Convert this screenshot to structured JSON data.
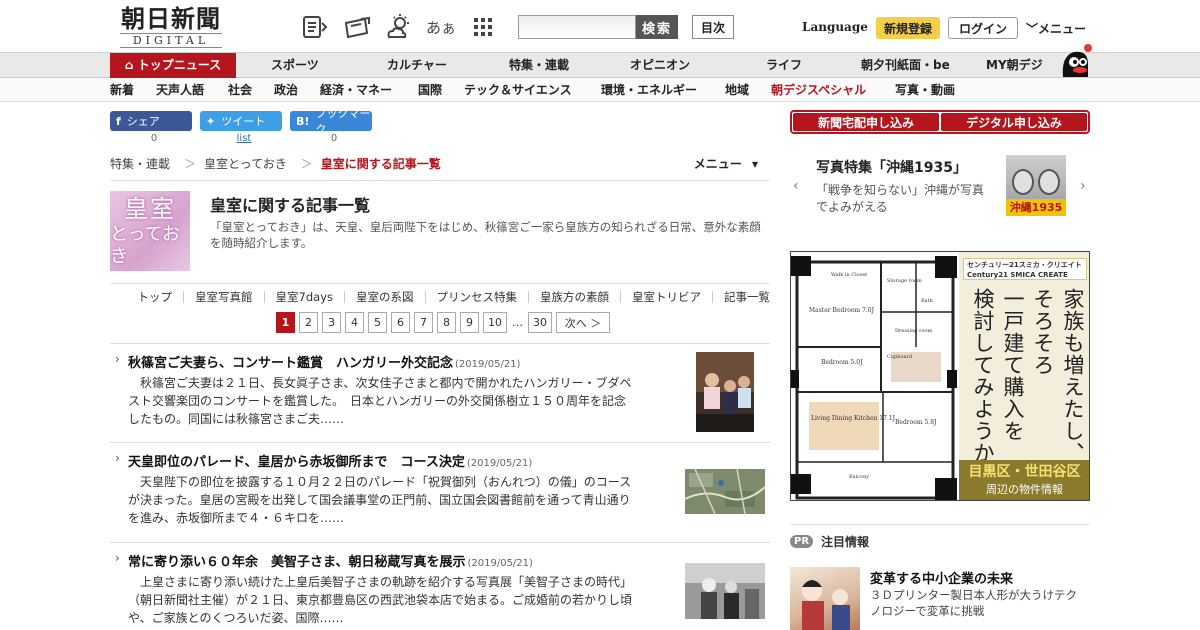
{
  "header": {
    "logo_jp": "朝日新聞",
    "logo_en": "DIGITAL",
    "icons": [
      "paper-icon",
      "ticket-icon",
      "weather-icon",
      "font-size-icon",
      "grid-icon"
    ],
    "font_size_label": "あぁ",
    "search_placeholder": "",
    "search_button": "検索",
    "mokuji_button": "目次",
    "language_link": "Language",
    "register_button": "新規登録",
    "login_button": "ログイン",
    "menu_label": "メニュー"
  },
  "nav1": {
    "home": "トップニュース",
    "items": [
      "スポーツ",
      "カルチャー",
      "特集・連載",
      "オピニオン",
      "ライフ",
      "朝夕刊紙面・be",
      "MY朝デジ"
    ]
  },
  "nav2": {
    "items": [
      "新着",
      "天声人語",
      "社会",
      "政治",
      "経済・マネー",
      "国際",
      "テック＆サイエンス",
      "環境・エネルギー",
      "地域",
      "朝デジスペシャル",
      "写真・動画"
    ]
  },
  "share": {
    "facebook_label": "シェア",
    "twitter_label": "ツイート",
    "hatena_label": "ブックマーク",
    "facebook_count": "0",
    "twitter_count": "list",
    "hatena_count": "0"
  },
  "breadcrumb": {
    "items": [
      "特集・連載",
      "皇室とっておき"
    ],
    "current": "皇室に関する記事一覧",
    "menu": "メニュー"
  },
  "section": {
    "thumb_line1": "皇室",
    "thumb_line2": "とっておき",
    "title": "皇室に関する記事一覧",
    "description": "「皇室とっておき」は、天皇、皇后両陛下をはじめ、秋篠宮ご一家ら皇族方の知られざる日常、意外な素顔を随時紹介します。"
  },
  "subnav": [
    "トップ",
    "皇室写真館",
    "皇室7days",
    "皇室の系図",
    "プリンセス特集",
    "皇族方の素顔",
    "皇室トリビア",
    "記事一覧"
  ],
  "pager": {
    "pages": [
      "1",
      "2",
      "3",
      "4",
      "5",
      "6",
      "7",
      "8",
      "9",
      "10"
    ],
    "current": "1",
    "dots": "…",
    "last": "30",
    "next": "次へ ＞"
  },
  "articles": [
    {
      "title": "秋篠宮ご夫妻ら、コンサート鑑賞　ハンガリー外交記念",
      "date": "(2019/05/21)",
      "body": [
        "　秋篠宮ご夫妻は２１日、長女眞子さま、次女佳子さまと都内で開かれたハンガリー・ブダペ",
        "スト交響楽団のコンサートを鑑賞した。　日本とハンガリーの外交関係樹立１５０周年を記念",
        "したもの。同国には秋篠宮さまご夫……"
      ]
    },
    {
      "title": "天皇即位のパレード、皇居から赤坂御所まで　コース決定",
      "date": "(2019/05/21)",
      "body": [
        "　天皇陛下の即位を披露する１０月２２日のパレード「祝賀御列（おんれつ）の儀」のコース",
        "が決まった。皇居の宮殿を出発して国会議事堂の正門前、国立国会図書館前を通って青山通り",
        "を進み、赤坂御所まで４・６キロを……"
      ]
    },
    {
      "title": "常に寄り添い６０年余　美智子さま、朝日秘蔵写真を展示",
      "date": "(2019/05/21)",
      "body": [
        "　上皇さまに寄り添い続けた上皇后美智子さまの軌跡を紹介する写真展「美智子さまの時代」",
        "（朝日新聞社主催）が２１日、東京都豊島区の西武池袋本店で始まる。ご成婚前の若かりし頃",
        "や、ご家族とのくつろいだ姿、国際……"
      ]
    }
  ],
  "right": {
    "apply_home": "新聞宅配申し込み",
    "apply_digital": "デジタル申し込み",
    "promo_title": "写真特集「沖縄1935」",
    "promo_text": "「戦争を知らない」沖縄が写真でよみがえる",
    "promo_label": "沖縄1935",
    "ad_logo_line1": "センチュリー21スミカ・クリエイト",
    "ad_logo_line2": "Century21 SMICA CREATE",
    "ad_copy": [
      "家族も増えたし、",
      "そろそろ",
      "一戸建て購入を",
      "検討してみようか。"
    ],
    "ad_foot_big": "目黒区・世田谷区",
    "ad_foot_small": "周辺の物件情報",
    "ad_rooms": [
      "Master Bedroom 7.0J",
      "Bedroom 5.0J",
      "Living Dining Kitchen 17.1J",
      "Bedroom 5.8J",
      "Walk in Closet",
      "Storage room",
      "Dressing room",
      "Bath",
      "Cupboard",
      "Balcony"
    ],
    "pr_badge": "PR",
    "pr_title": "注目情報",
    "pr_item_title": "変革する中小企業の未来",
    "pr_item_text": "３Ｄプリンター製日本人形が大うけテクノロジーで変革に挑戦"
  },
  "colors": {
    "brand_red": "#b5151c",
    "register_yellow": "#f3cf47",
    "facebook_blue": "#3b5998",
    "twitter_blue": "#3f9ee8",
    "hatena_blue": "#3a86d8"
  }
}
